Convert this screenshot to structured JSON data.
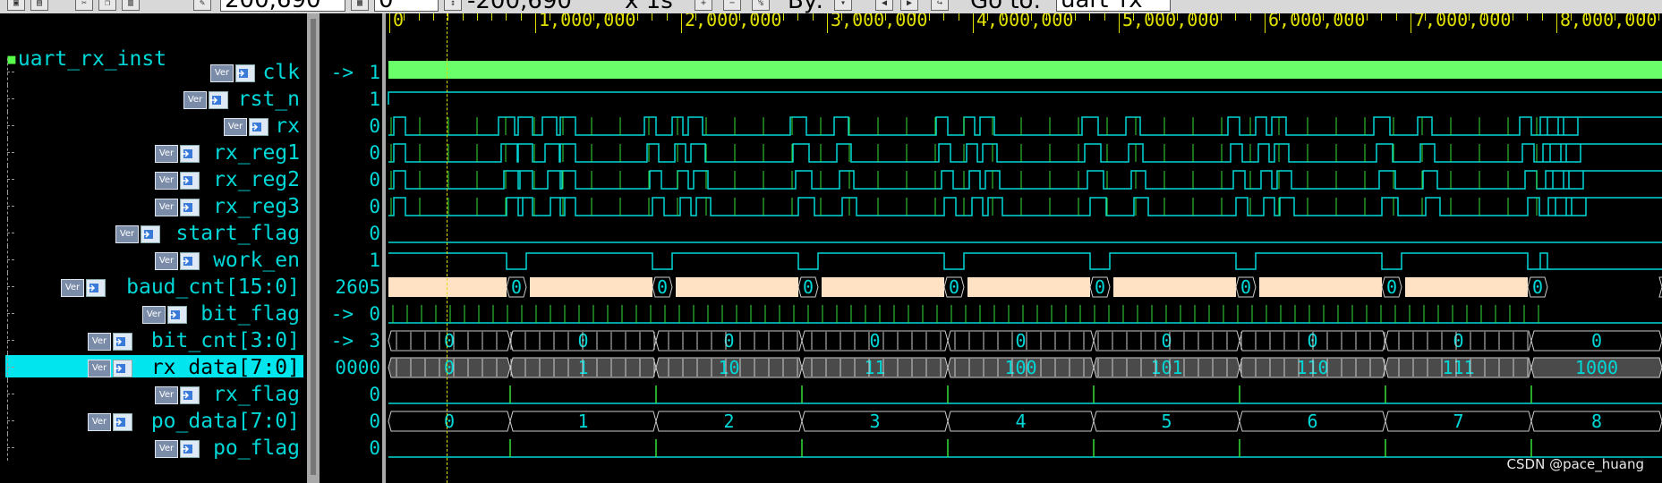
{
  "toolbar": {
    "time_field": "200,690",
    "delta_field": "0",
    "offset_text": "-200,690",
    "zoom_text": "x 1s",
    "by_label": "By:",
    "goto_label": "Go to:",
    "goto_field": "uart_rx_"
  },
  "instance": {
    "name": "uart_rx_inst"
  },
  "signals": [
    {
      "name": "clk",
      "value": "1",
      "arrow": "->",
      "icon": "input-port-icon"
    },
    {
      "name": "rst_n",
      "value": "1",
      "arrow": "",
      "icon": "input-port-icon"
    },
    {
      "name": "rx",
      "value": "0",
      "arrow": "",
      "icon": "input-port-icon"
    },
    {
      "name": "rx_reg1",
      "value": "0",
      "arrow": "",
      "icon": "register-icon"
    },
    {
      "name": "rx_reg2",
      "value": "0",
      "arrow": "",
      "icon": "register-icon"
    },
    {
      "name": "rx_reg3",
      "value": "0",
      "arrow": "",
      "icon": "register-icon"
    },
    {
      "name": "start_flag",
      "value": "0",
      "arrow": "",
      "icon": "register-icon"
    },
    {
      "name": "work_en",
      "value": "1",
      "arrow": "",
      "icon": "register-icon"
    },
    {
      "name": "baud_cnt[15:0]",
      "value": "2605",
      "arrow": "",
      "icon": "register-icon"
    },
    {
      "name": "bit_flag",
      "value": "0",
      "arrow": "->",
      "icon": "register-icon"
    },
    {
      "name": "bit_cnt[3:0]",
      "value": "3",
      "arrow": "->",
      "icon": "register-icon"
    },
    {
      "name": "rx_data[7:0]",
      "value": "0000",
      "arrow": "",
      "icon": "register-icon"
    },
    {
      "name": "rx_flag",
      "value": "0",
      "arrow": "",
      "icon": "register-icon"
    },
    {
      "name": "po_data[7:0]",
      "value": "0",
      "arrow": "",
      "icon": "output-port-icon"
    },
    {
      "name": "po_flag",
      "value": "0",
      "arrow": "",
      "icon": "output-port-icon"
    }
  ],
  "ver_badge": "Ver",
  "ruler": [
    "0",
    "1,000,000",
    "2,000,000",
    "3,000,000",
    "4,000,000",
    "5,000,000",
    "6,000,000",
    "7,000,000",
    "8,000,000"
  ],
  "baud_cnt_labels": [
    "0",
    "0",
    "0",
    "0",
    "0",
    "0",
    "0",
    "0",
    "0"
  ],
  "bit_cnt_labels": [
    "0",
    "0",
    "0",
    "0",
    "0",
    "0",
    "0",
    "0",
    "0"
  ],
  "rx_data_labels": [
    "0",
    "1",
    "10",
    "11",
    "100",
    "101",
    "110",
    "111",
    "1000"
  ],
  "po_data_labels": [
    "0",
    "1",
    "2",
    "3",
    "4",
    "5",
    "6",
    "7",
    "8"
  ],
  "colors": {
    "clk": "#6aff6a",
    "wave": "#00d8d8",
    "edge": "#36e036",
    "baud_fill": "#ffe2c4",
    "grey_bus": "#4a4a4a",
    "highlight": "#00e5ee",
    "ruler": "#e0e000"
  },
  "watermark": "CSDN @pace_huang"
}
